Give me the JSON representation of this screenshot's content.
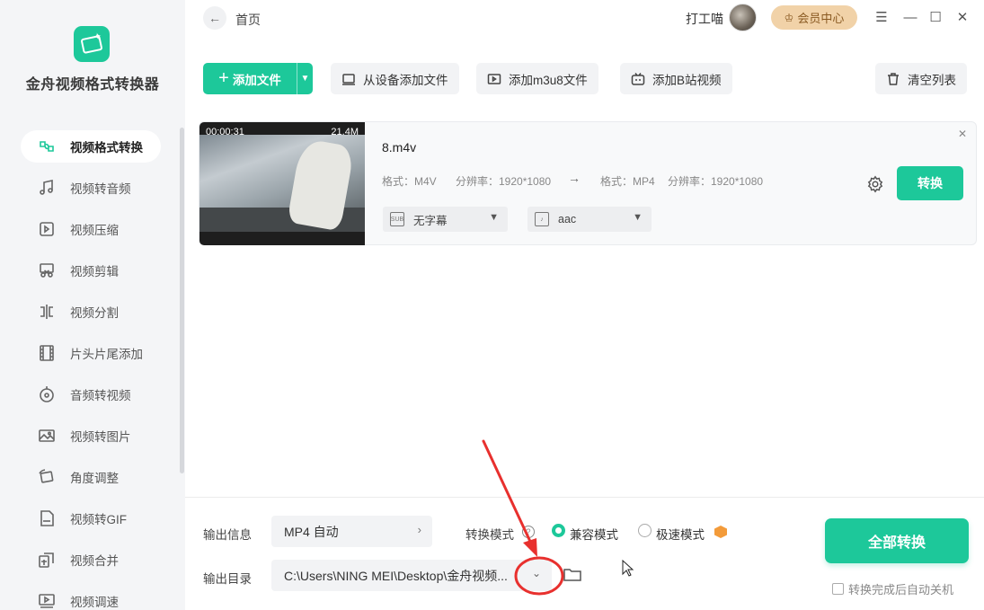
{
  "app": {
    "name": "金舟视频格式转换器"
  },
  "sidebar": {
    "items": [
      {
        "label": "视频格式转换",
        "icon": "format-convert-icon",
        "active": true
      },
      {
        "label": "视频转音频",
        "icon": "music-note-icon"
      },
      {
        "label": "视频压缩",
        "icon": "compress-icon"
      },
      {
        "label": "视频剪辑",
        "icon": "scissors-icon"
      },
      {
        "label": "视频分割",
        "icon": "split-icon"
      },
      {
        "label": "片头片尾添加",
        "icon": "film-strip-icon"
      },
      {
        "label": "音频转视频",
        "icon": "audio-disc-icon"
      },
      {
        "label": "视频转图片",
        "icon": "image-icon"
      },
      {
        "label": "角度调整",
        "icon": "rotate-icon"
      },
      {
        "label": "视频转GIF",
        "icon": "gif-icon"
      },
      {
        "label": "视频合并",
        "icon": "merge-icon"
      },
      {
        "label": "视频调速",
        "icon": "speed-icon"
      }
    ]
  },
  "topbar": {
    "breadcrumb": "首页",
    "username": "打工喵",
    "vip_label": "会员中心"
  },
  "toolbar": {
    "add_file": "添加文件",
    "add_from_device": "从设备添加文件",
    "add_m3u8": "添加m3u8文件",
    "add_bilibili": "添加B站视频",
    "clear_list": "清空列表"
  },
  "file": {
    "duration": "00:00:31",
    "size": "21.4M",
    "name": "8.m4v",
    "src_format_label": "格式：M4V",
    "src_res_label": "分辨率：1920*1080",
    "dst_format_label": "格式：MP4",
    "dst_res_label": "分辨率：1920*1080",
    "subtitle": "无字幕",
    "audio": "aac",
    "convert": "转换"
  },
  "bottom": {
    "output_info_label": "输出信息",
    "output_info_value": "MP4 自动",
    "mode_label": "转换模式",
    "mode_compat": "兼容模式",
    "mode_fast": "极速模式",
    "output_dir_label": "输出目录",
    "output_dir_value": "C:\\Users\\NING MEI\\Desktop\\金舟视频...",
    "convert_all": "全部转换",
    "auto_shutdown": "转换完成后自动关机"
  },
  "colors": {
    "accent": "#1dc89a",
    "annotation": "#e8302e",
    "vip": "#f1d2a8"
  }
}
